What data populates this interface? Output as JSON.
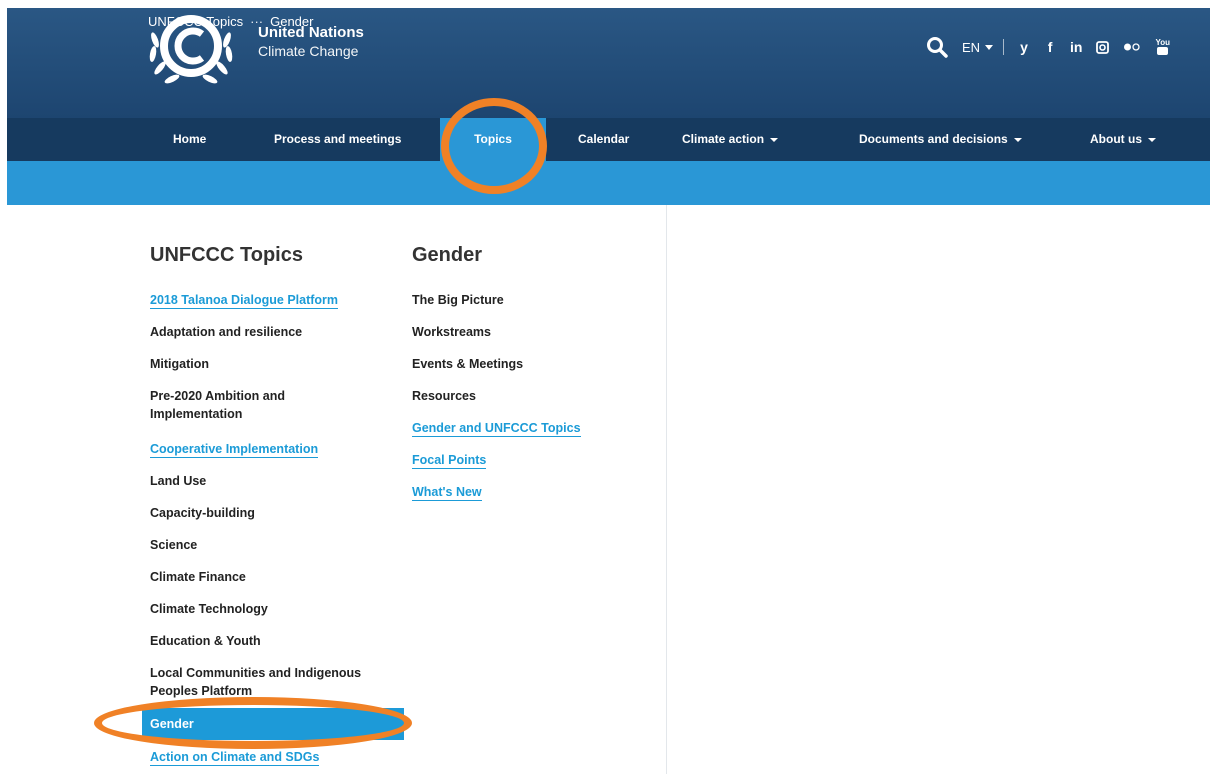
{
  "brand": {
    "line1": "United Nations",
    "line2": "Climate Change"
  },
  "header_tools": {
    "language": "EN",
    "social": {
      "twitter": "y",
      "facebook": "f",
      "linkedin": "in",
      "youtube": "You"
    }
  },
  "nav": {
    "home": "Home",
    "process": "Process and meetings",
    "topics": "Topics",
    "calendar": "Calendar",
    "climate_action": "Climate action",
    "documents": "Documents and decisions",
    "about": "About us"
  },
  "breadcrumb": {
    "parent": "UNFCCC Topics",
    "separator": "···",
    "current": "Gender"
  },
  "topics_col": {
    "title": "UNFCCC Topics",
    "items": [
      "2018 Talanoa Dialogue Platform",
      "Adaptation and resilience",
      "Mitigation",
      "Pre-2020 Ambition and Implementation",
      "Cooperative Implementation",
      "Land Use",
      "Capacity-building",
      "Science",
      "Climate Finance",
      "Climate Technology",
      "Education & Youth",
      "Local Communities and Indigenous Peoples Platform",
      "Gender",
      "Action on Climate and SDGs"
    ]
  },
  "gender_col": {
    "title": "Gender",
    "items": [
      "The Big Picture",
      "Workstreams",
      "Events & Meetings",
      "Resources",
      "Gender and UNFCCC Topics",
      "Focal Points",
      "What's New"
    ]
  },
  "colors": {
    "header_blue": "#1d4570",
    "nav_dark": "#163a5f",
    "accent_blue": "#2a97d6",
    "link_blue": "#1b9bd7",
    "annotation_orange": "#f08126"
  }
}
